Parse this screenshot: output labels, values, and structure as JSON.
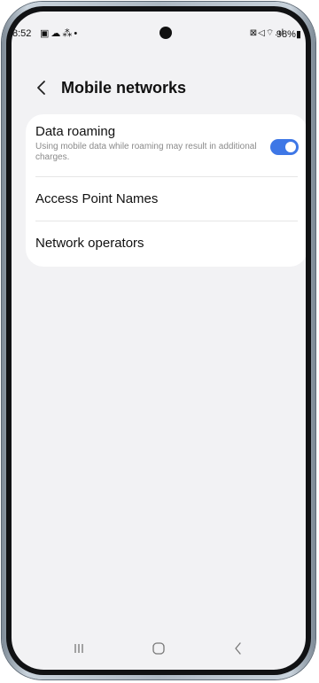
{
  "status_bar": {
    "time": "8:52",
    "left_icons": "▣☁⁂•",
    "right_icons": "⊠◁⌔.ıl",
    "battery": "98%▮"
  },
  "header": {
    "title": "Mobile networks"
  },
  "settings": {
    "data_roaming": {
      "title": "Data roaming",
      "description": "Using mobile data while roaming may result in additional charges.",
      "enabled": true
    },
    "access_point_names": {
      "title": "Access Point Names"
    },
    "network_operators": {
      "title": "Network operators"
    }
  },
  "colors": {
    "accent": "#3e77e6",
    "background": "#f2f2f4",
    "card": "#ffffff"
  },
  "icons": {
    "back": "chevron-left-icon",
    "nav_recents": "recents-icon",
    "nav_home": "home-icon",
    "nav_back": "back-icon"
  }
}
